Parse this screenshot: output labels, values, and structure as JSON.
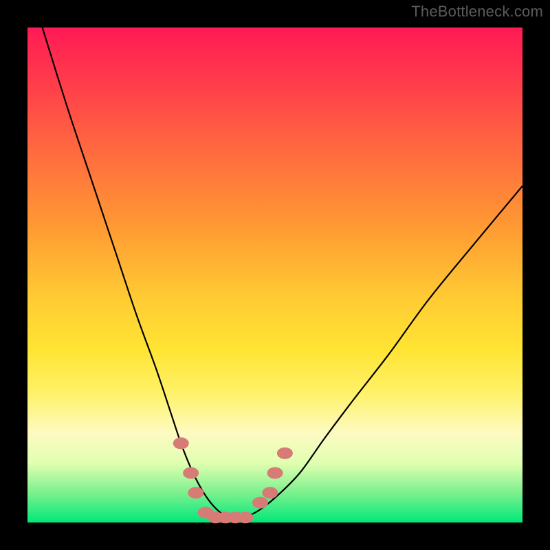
{
  "watermark": "TheBottleneck.com",
  "colors": {
    "frame": "#000000",
    "gradient_top": "#ff1a55",
    "gradient_bottom": "#00e87a",
    "curve": "#000000",
    "dots": "#d77b76"
  },
  "chart_data": {
    "type": "line",
    "title": "",
    "xlabel": "",
    "ylabel": "",
    "xlim": [
      0,
      100
    ],
    "ylim": [
      0,
      100
    ],
    "note": "Axes are unlabeled in the source image; values are estimated as percentages of the plot area width/height. Higher y indicates a worse bottleneck (red); the valley near y≈0 is the optimal (green) region.",
    "series": [
      {
        "name": "bottleneck-curve",
        "x": [
          3,
          8,
          13,
          18,
          22,
          26,
          29,
          31,
          33,
          35,
          37,
          39,
          41,
          43,
          46,
          50,
          55,
          60,
          66,
          73,
          81,
          90,
          100
        ],
        "y": [
          100,
          84,
          69,
          54,
          42,
          31,
          22,
          16,
          11,
          7,
          4,
          2,
          1,
          1,
          2,
          5,
          10,
          17,
          25,
          34,
          45,
          56,
          68
        ]
      }
    ],
    "points": [
      {
        "name": "cluster-left-1",
        "x": 31,
        "y": 16
      },
      {
        "name": "cluster-left-2",
        "x": 33,
        "y": 10
      },
      {
        "name": "cluster-left-3",
        "x": 34,
        "y": 6
      },
      {
        "name": "valley-1",
        "x": 36,
        "y": 2
      },
      {
        "name": "valley-2",
        "x": 38,
        "y": 1
      },
      {
        "name": "valley-3",
        "x": 40,
        "y": 1
      },
      {
        "name": "valley-4",
        "x": 42,
        "y": 1
      },
      {
        "name": "valley-5",
        "x": 44,
        "y": 1
      },
      {
        "name": "cluster-right-1",
        "x": 47,
        "y": 4
      },
      {
        "name": "cluster-right-2",
        "x": 49,
        "y": 6
      },
      {
        "name": "cluster-right-3",
        "x": 50,
        "y": 10
      },
      {
        "name": "cluster-right-4",
        "x": 52,
        "y": 14
      }
    ]
  }
}
